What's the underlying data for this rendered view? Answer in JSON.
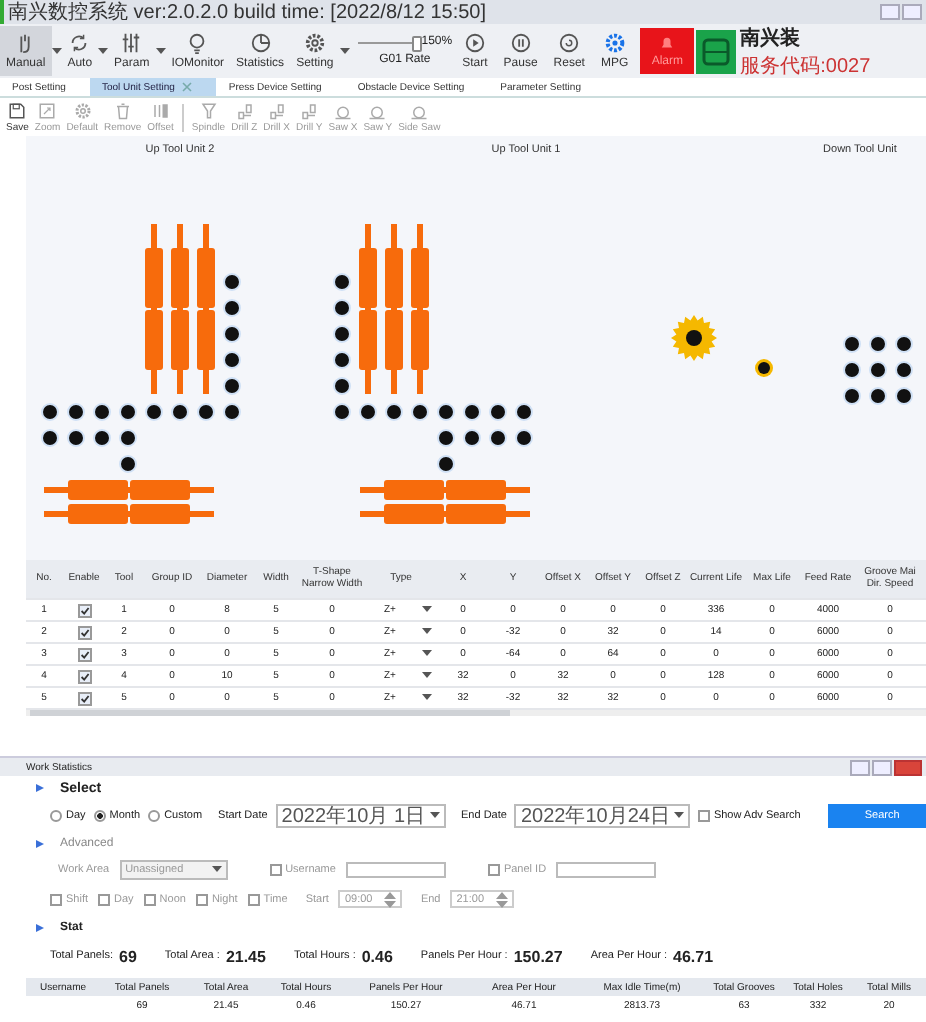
{
  "window": {
    "title": "南兴数控系统 ver:2.0.2.0 build time: [2022/8/12 15:50]"
  },
  "toolbar": {
    "buttons": [
      {
        "label": "Manual",
        "kind": "dropdown"
      },
      {
        "label": "Auto",
        "kind": "dropdown"
      },
      {
        "label": "Param",
        "kind": "dropdown"
      },
      {
        "label": "IOMonitor",
        "kind": "plain"
      },
      {
        "label": "Statistics",
        "kind": "plain"
      },
      {
        "label": "Setting",
        "kind": "dropdown"
      }
    ],
    "rate": {
      "level": 1,
      "reading": "150%",
      "label": "G01 Rate"
    },
    "run_buttons": [
      {
        "label": "Start"
      },
      {
        "label": "Pause"
      },
      {
        "label": "Reset"
      },
      {
        "label": "MPG"
      }
    ],
    "alarm": {
      "label": "Alarm"
    },
    "brand": {
      "name": "南兴装",
      "service": "服务代码:0027"
    }
  },
  "tabs": [
    {
      "label": "Post Setting",
      "selected": false
    },
    {
      "label": "Tool Unit Setting",
      "selected": true
    },
    {
      "label": "Press Device Setting",
      "selected": false
    },
    {
      "label": "Obstacle Device Setting",
      "selected": false
    },
    {
      "label": "Parameter Setting",
      "selected": false
    }
  ],
  "edit_tools": [
    {
      "label": "Save",
      "disabled": false
    },
    {
      "label": "Zoom",
      "disabled": true
    },
    {
      "label": "Default",
      "disabled": true
    },
    {
      "label": "Remove",
      "disabled": true
    },
    {
      "label": "Offset",
      "disabled": true
    }
  ],
  "insert_tools": [
    {
      "label": "Spindle",
      "disabled": true
    },
    {
      "label": "Drill Z",
      "disabled": true
    },
    {
      "label": "Drill X",
      "disabled": true
    },
    {
      "label": "Drill Y",
      "disabled": true
    },
    {
      "label": "Saw X",
      "disabled": true
    },
    {
      "label": "Saw Y",
      "disabled": true
    },
    {
      "label": "Side Saw",
      "disabled": true
    }
  ],
  "canvas": {
    "units": [
      {
        "label": "Up Tool Unit 2"
      },
      {
        "label": "Up Tool Unit 1"
      },
      {
        "label": "Down Tool Unit"
      }
    ]
  },
  "tool_table": {
    "columns": [
      {
        "label": "No.",
        "kind": "text"
      },
      {
        "label": "Enable",
        "kind": "check"
      },
      {
        "label": "Tool",
        "kind": "text"
      },
      {
        "label": "Group ID",
        "kind": "text"
      },
      {
        "label": "Diameter",
        "kind": "text"
      },
      {
        "label": "Width",
        "kind": "text"
      },
      {
        "label": "T-Shape Narrow Width",
        "kind": "text"
      },
      {
        "label": "Type",
        "kind": "select"
      },
      {
        "label": "X",
        "kind": "text"
      },
      {
        "label": "Y",
        "kind": "text"
      },
      {
        "label": "Offset X",
        "kind": "text"
      },
      {
        "label": "Offset Y",
        "kind": "text"
      },
      {
        "label": "Offset Z",
        "kind": "text"
      },
      {
        "label": "Current Life",
        "kind": "text"
      },
      {
        "label": "Max Life",
        "kind": "text"
      },
      {
        "label": "Feed Rate",
        "kind": "text"
      },
      {
        "label": "Groove Mai\nDir. Speed",
        "kind": "text"
      }
    ],
    "rows": [
      {
        "enabled": true,
        "values": [
          "1",
          "1",
          "0",
          "8",
          "5",
          "0",
          "Z+",
          "0",
          "0",
          "0",
          "0",
          "0",
          "336",
          "0",
          "4000",
          "0"
        ]
      },
      {
        "enabled": true,
        "values": [
          "2",
          "2",
          "0",
          "0",
          "5",
          "0",
          "Z+",
          "0",
          "-32",
          "0",
          "32",
          "0",
          "14",
          "0",
          "6000",
          "0"
        ]
      },
      {
        "enabled": true,
        "values": [
          "3",
          "3",
          "0",
          "0",
          "5",
          "0",
          "Z+",
          "0",
          "-64",
          "0",
          "64",
          "0",
          "0",
          "0",
          "6000",
          "0"
        ]
      },
      {
        "enabled": true,
        "values": [
          "4",
          "4",
          "0",
          "10",
          "5",
          "0",
          "Z+",
          "32",
          "0",
          "32",
          "0",
          "0",
          "128",
          "0",
          "6000",
          "0"
        ]
      },
      {
        "enabled": true,
        "values": [
          "5",
          "5",
          "0",
          "0",
          "5",
          "0",
          "Z+",
          "32",
          "-32",
          "32",
          "32",
          "0",
          "0",
          "0",
          "6000",
          "0"
        ]
      }
    ]
  },
  "stats_window": {
    "title": "Work Statistics",
    "select": {
      "heading": "Select",
      "modes": [
        {
          "label": "Day",
          "selected": false
        },
        {
          "label": "Month",
          "selected": true
        },
        {
          "label": "Custom",
          "selected": false
        }
      ],
      "start_label": "Start Date",
      "start_date": "2022年10月 1日",
      "end_label": "End Date",
      "end_date": "2022年10月24日",
      "adv": {
        "label": "Show Adv Search",
        "checked": false
      },
      "search_button": "Search"
    },
    "advanced": {
      "heading": "Advanced",
      "disabled": true,
      "work_area_label": "Work Area",
      "work_area": "Unassigned",
      "username": {
        "label": "Username",
        "checked": false
      },
      "panel_id": {
        "label": "Panel ID",
        "checked": false
      },
      "shifts": [
        {
          "label": "Shift",
          "checked": false
        },
        {
          "label": "Day",
          "checked": false
        },
        {
          "label": "Noon",
          "checked": false
        },
        {
          "label": "Night",
          "checked": false
        }
      ],
      "time": {
        "label": "Time",
        "checked": false
      },
      "start_label": "Start",
      "start": "09:00",
      "end_label": "End",
      "end": "21:00"
    },
    "stat": {
      "heading": "Stat",
      "totals": [
        {
          "label": "Total Panels:",
          "value": "69"
        },
        {
          "label": "Total Area :",
          "value": "21.45"
        },
        {
          "label": "Total Hours :",
          "value": "0.46"
        },
        {
          "label": "Panels Per Hour :",
          "value": "150.27"
        },
        {
          "label": "Area Per Hour :",
          "value": "46.71"
        }
      ]
    },
    "table": {
      "columns": [
        "Username",
        "Total Panels",
        "Total Area",
        "Total Hours",
        "Panels Per Hour",
        "Area Per Hour",
        "Max Idle Time(m)",
        "Total Grooves",
        "Total Holes",
        "Total Mills"
      ],
      "rows": [
        [
          "",
          "69",
          "21.45",
          "0.46",
          "150.27",
          "46.71",
          "2813.73",
          "63",
          "332",
          "20"
        ]
      ]
    }
  }
}
